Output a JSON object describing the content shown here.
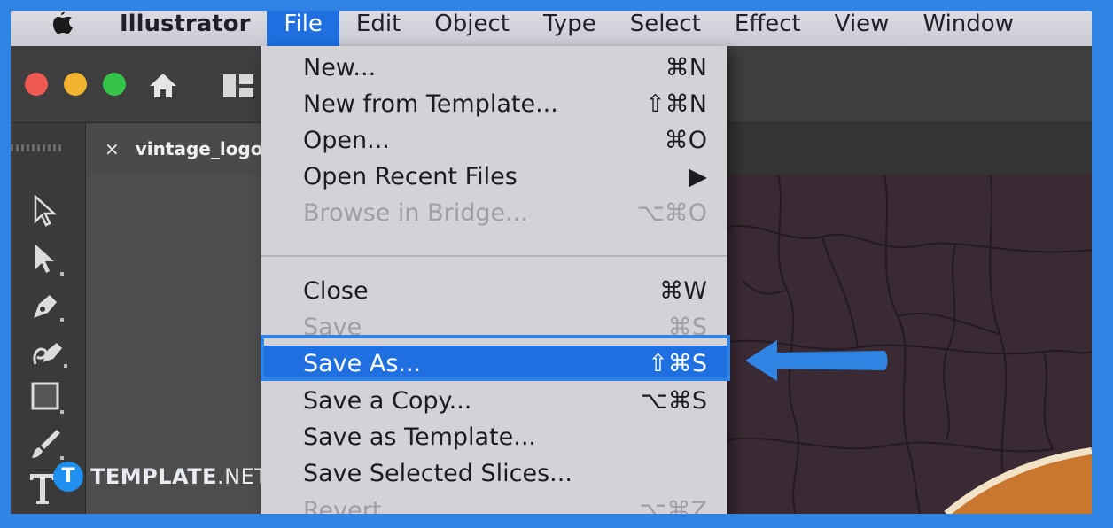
{
  "menubar": {
    "app_name": "Illustrator",
    "items": [
      "File",
      "Edit",
      "Object",
      "Type",
      "Select",
      "Effect",
      "View",
      "Window"
    ],
    "active_item": "File"
  },
  "document_tab": {
    "close_glyph": "×",
    "title": "vintage_logo"
  },
  "file_menu": {
    "items": [
      {
        "label": "New...",
        "shortcut": "⌘N",
        "state": "enabled"
      },
      {
        "label": "New from Template...",
        "shortcut": "⇧⌘N",
        "state": "enabled"
      },
      {
        "label": "Open...",
        "shortcut": "⌘O",
        "state": "enabled"
      },
      {
        "label": "Open Recent Files",
        "shortcut": "▶",
        "state": "enabled"
      },
      {
        "label": "Browse in Bridge...",
        "shortcut": "⌥⌘O",
        "state": "disabled"
      },
      {
        "label": "Close",
        "shortcut": "⌘W",
        "state": "enabled"
      },
      {
        "label": "Save",
        "shortcut": "⌘S",
        "state": "disabled"
      },
      {
        "label": "Save As...",
        "shortcut": "⇧⌘S",
        "state": "selected"
      },
      {
        "label": "Save a Copy...",
        "shortcut": "⌥⌘S",
        "state": "enabled"
      },
      {
        "label": "Save as Template...",
        "shortcut": "",
        "state": "enabled"
      },
      {
        "label": "Save Selected Slices...",
        "shortcut": "",
        "state": "enabled"
      },
      {
        "label": "Revert",
        "shortcut": "⌥⌘Z",
        "state": "disabled"
      }
    ]
  },
  "watermark": {
    "badge": "T",
    "brand_bold": "TEMPLATE",
    "brand_light": ".NET"
  },
  "colors": {
    "frame_border": "#2f84e3",
    "menu_highlight": "#1f6fe0",
    "traffic_red": "#ee5a52",
    "traffic_yellow": "#f3b52f",
    "traffic_green": "#35c44a",
    "artboard": "#3a2a33",
    "logo_orange": "#c9762f"
  },
  "icons": [
    "apple-icon",
    "home-icon",
    "workspace-icon",
    "direct-selection-icon",
    "selection-icon",
    "pen-icon",
    "curvature-icon",
    "rectangle-icon",
    "brush-icon",
    "type-icon",
    "callout-arrow-icon"
  ]
}
